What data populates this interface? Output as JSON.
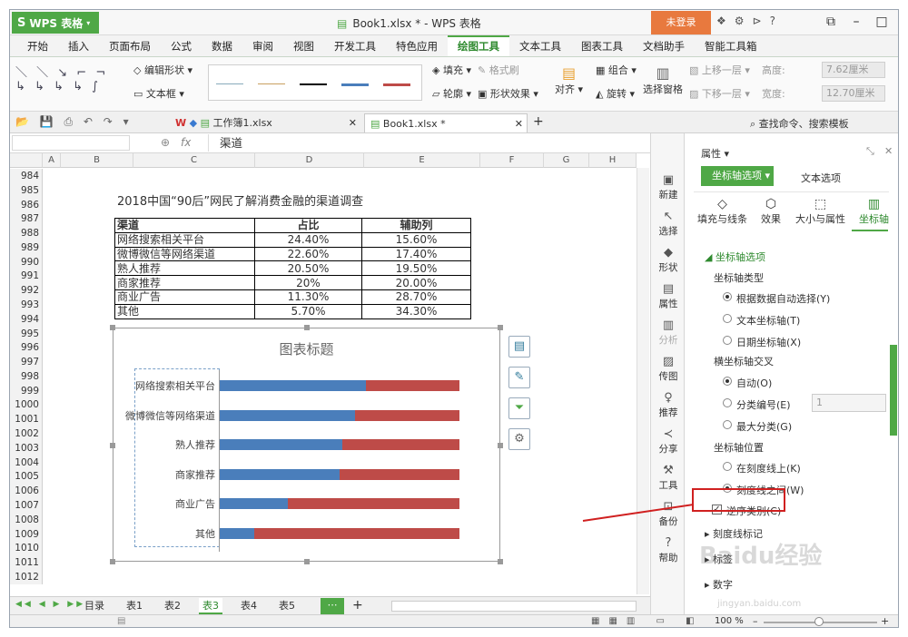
{
  "app": {
    "name": "WPS 表格",
    "title": "Book1.xlsx * - WPS 表格",
    "login": "未登录"
  },
  "menu": [
    "开始",
    "插入",
    "页面布局",
    "公式",
    "数据",
    "审阅",
    "视图",
    "开发工具",
    "特色应用",
    "绘图工具",
    "文本工具",
    "图表工具",
    "文档助手",
    "智能工具箱"
  ],
  "menu_active": "绘图工具",
  "ribbon": {
    "edit_shape": "编辑形状",
    "textbox": "文本框",
    "fill": "填充",
    "format_brush": "格式刷",
    "outline": "轮廓",
    "shape_effect": "形状效果",
    "align": "对齐",
    "group": "组合",
    "rotate": "旋转",
    "select_pane": "选择窗格",
    "move_up": "上移一层",
    "move_down": "下移一层",
    "height_label": "高度:",
    "height_value": "7.62厘米",
    "width_label": "宽度:",
    "width_value": "12.70厘米"
  },
  "doc_tabs": [
    {
      "label": "工作簿1.xlsx"
    },
    {
      "label": "Book1.xlsx *"
    }
  ],
  "search_cmd": "查找命令、搜索模板",
  "formula": {
    "fx": "fx",
    "content": "渠道"
  },
  "columns": [
    "A",
    "B",
    "C",
    "D",
    "E",
    "F",
    "G",
    "H"
  ],
  "rows": [
    "984",
    "985",
    "986",
    "987",
    "988",
    "989",
    "990",
    "991",
    "992",
    "993",
    "994",
    "995",
    "996",
    "997",
    "998",
    "999",
    "1000",
    "1001",
    "1002",
    "1003",
    "1004",
    "1005",
    "1006",
    "1007",
    "1008",
    "1009",
    "1010",
    "1011",
    "1012"
  ],
  "sheet_title": "2018中国“90后”网民了解消费金融的渠道调查",
  "table": {
    "headers": [
      "渠道",
      "占比",
      "辅助列"
    ],
    "rows": [
      [
        "网络搜索相关平台",
        "24.40%",
        "15.60%"
      ],
      [
        "微博微信等网络渠道",
        "22.60%",
        "17.40%"
      ],
      [
        "熟人推荐",
        "20.50%",
        "19.50%"
      ],
      [
        "商家推荐",
        "20%",
        "20.00%"
      ],
      [
        "商业广告",
        "11.30%",
        "28.70%"
      ],
      [
        "其他",
        "5.70%",
        "34.30%"
      ]
    ]
  },
  "chart_data": {
    "type": "bar",
    "orientation": "horizontal",
    "stacked": true,
    "title": "图表标题",
    "categories": [
      "网络搜索相关平台",
      "微博微信等网络渠道",
      "熟人推荐",
      "商家推荐",
      "商业广告",
      "其他"
    ],
    "series": [
      {
        "name": "占比",
        "values": [
          24.4,
          22.6,
          20.5,
          20.0,
          11.3,
          5.7
        ],
        "color": "#4a7ebb"
      },
      {
        "name": "辅助列",
        "values": [
          15.6,
          17.4,
          19.5,
          20.0,
          28.7,
          34.3
        ],
        "color": "#be4b48"
      }
    ],
    "xlim": [
      0,
      40
    ],
    "grid": false,
    "legend": "none"
  },
  "sheets": [
    "目录",
    "表1",
    "表2",
    "表3",
    "表4",
    "表5"
  ],
  "active_sheet": "表3",
  "side_tools": [
    "新建",
    "选择",
    "形状",
    "属性",
    "分析",
    "传图",
    "推荐",
    "分享",
    "工具",
    "备份",
    "帮助"
  ],
  "pane": {
    "header": "属性",
    "tab_axis": "坐标轴选项",
    "tab_text": "文本选项",
    "subtabs": [
      "填充与线条",
      "效果",
      "大小与属性",
      "坐标轴"
    ],
    "section": "坐标轴选项",
    "axis_type_label": "坐标轴类型",
    "axis_type_options": [
      "根据数据自动选择(Y)",
      "文本坐标轴(T)",
      "日期坐标轴(X)"
    ],
    "cross_label": "横坐标轴交叉",
    "cross_options": [
      "自动(O)",
      "分类编号(E)",
      "最大分类(G)"
    ],
    "cross_value": "1",
    "position_label": "坐标轴位置",
    "position_options": [
      "在刻度线上(K)",
      "刻度线之间(W)"
    ],
    "reverse_label": "逆序类别(C)",
    "reverse_checked": true,
    "collapsed": [
      "刻度线标记",
      "标签",
      "数字"
    ]
  },
  "zoom": "100 %",
  "watermark": "Baidu经验",
  "watermark_url": "jingyan.baidu.com",
  "colors": {
    "accent": "#4fa846",
    "login": "#e8793e",
    "highlight": "#d02020"
  }
}
